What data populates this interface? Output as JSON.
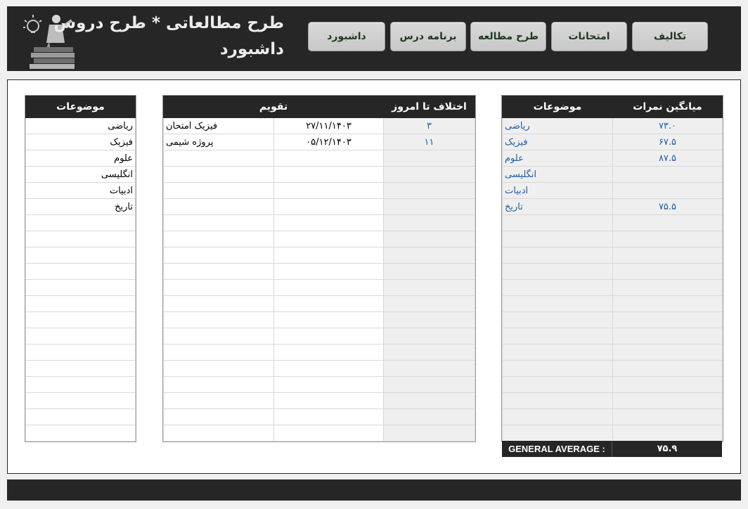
{
  "header": {
    "title_line1": "طرح مطالعاتی * طرح دروس",
    "title_line2": "داشبورد",
    "nav": [
      "تکالیف",
      "امتحانات",
      "طرح مطالعه",
      "برنامه درس",
      "داشبورد"
    ]
  },
  "subjects_table": {
    "header": "موضوعات",
    "rows": [
      "ریاضی",
      "فیزیک",
      "علوم",
      "انگلیسی",
      "ادبیات",
      "تاریخ"
    ]
  },
  "calendar_table": {
    "header_diff": "اختلاف تا امروز",
    "header_calendar": "تقویم",
    "rows": [
      {
        "diff": "۳",
        "date": "۲۷/۱۱/۱۴۰۳",
        "event": "فیزیک امتحان"
      },
      {
        "diff": "۱۱",
        "date": "۰۵/۱۲/۱۴۰۳",
        "event": "پروژه شیمی"
      }
    ]
  },
  "grades_table": {
    "header_avg": "میانگین نمرات",
    "header_subjects": "موضوعات",
    "rows": [
      {
        "subject": "ریاضی",
        "avg": "۷۳.۰"
      },
      {
        "subject": "فیزیک",
        "avg": "۶۷.۵"
      },
      {
        "subject": "علوم",
        "avg": "۸۷.۵"
      },
      {
        "subject": "انگلیسی",
        "avg": ""
      },
      {
        "subject": "ادبیات",
        "avg": ""
      },
      {
        "subject": "تاریخ",
        "avg": "۷۵.۵"
      }
    ],
    "general_average_label": "GENERAL AVERAGE :",
    "general_average_value": "۷۵.۹"
  },
  "colors": {
    "dark": "#262626",
    "accent_text": "#1f5fa6",
    "grey_cell": "#efefef"
  },
  "icons": {
    "logo": "lightbulb-books-student-icon"
  }
}
